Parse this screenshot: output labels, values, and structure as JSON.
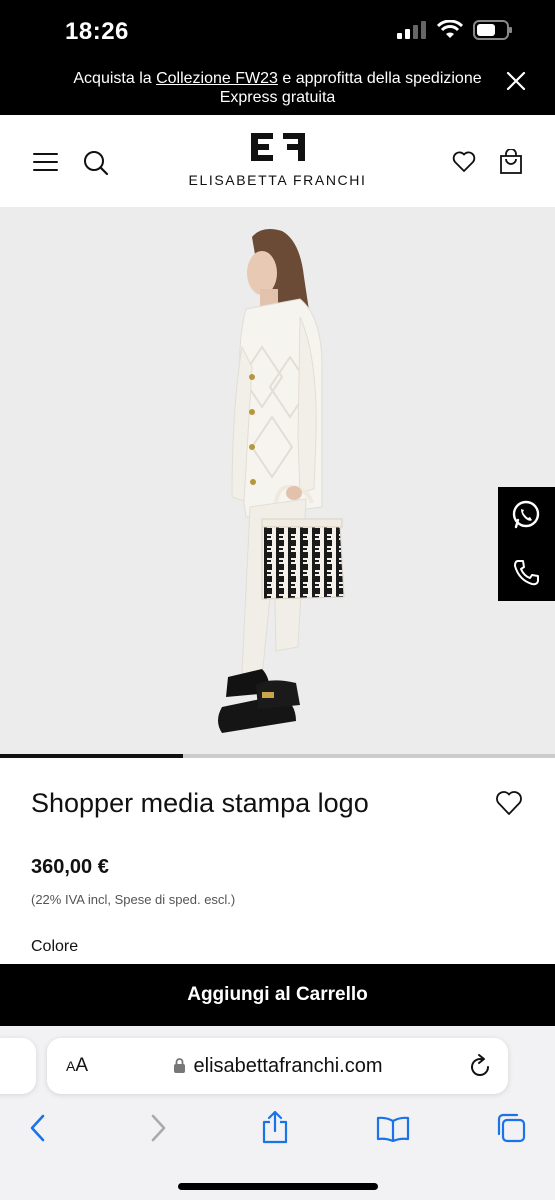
{
  "status_bar": {
    "time": "18:26"
  },
  "promo": {
    "text_before": "Acquista la ",
    "link": "Collezione FW23",
    "text_after": " e approfitta della spedizione Express gratuita"
  },
  "header": {
    "brand_name": "ELISABETTA FRANCHI",
    "logo_mark": "EF"
  },
  "gallery": {
    "progress": 0.33
  },
  "product": {
    "title": "Shopper media stampa logo",
    "price": "360,00 €",
    "tax_note": "(22% IVA incl, Spese di sped. escl.)",
    "color_label": "Colore"
  },
  "cart": {
    "label": "Aggiungi al Carrello"
  },
  "browser": {
    "text_size_label_small": "A",
    "text_size_label_large": "A",
    "url": "elisabettafranchi.com"
  },
  "colors": {
    "accent": "#000000",
    "background": "#ffffff",
    "hero_bg": "#ececec"
  }
}
